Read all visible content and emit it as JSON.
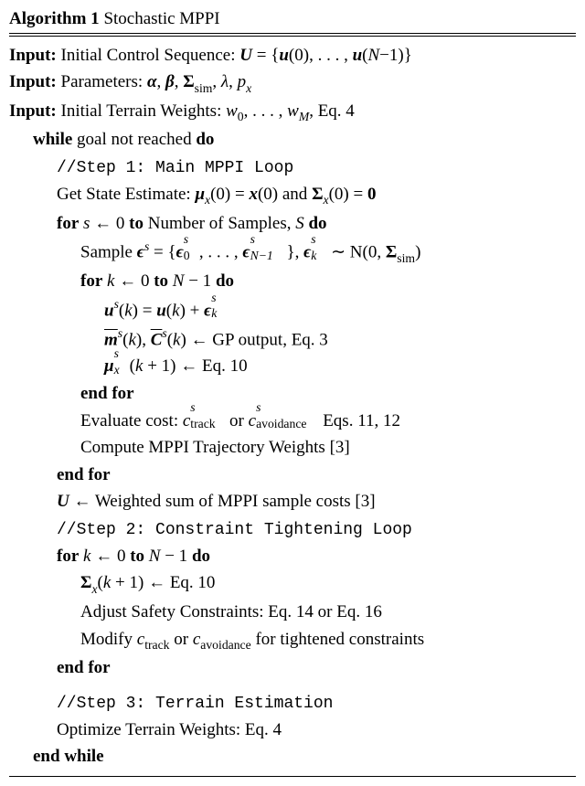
{
  "title": {
    "label_algorithm": "Algorithm 1",
    "name": "Stochastic MPPI"
  },
  "inputs": {
    "in1_label": "Input:",
    "in1_text_a": "Initial Control Sequence: ",
    "in1_U": "U",
    "in1_eq": " = {",
    "in1_u": "u",
    "in1_z0": "(0), . . . , ",
    "in1_u2": "u",
    "in1_z1": "(",
    "in1_N": "N",
    "in1_m1": "−1)}",
    "in2_label": "Input:",
    "in2_text": "Parameters: ",
    "in2_alpha": "α",
    "in2_c1": ", ",
    "in2_beta": "β",
    "in2_c2": ", ",
    "in2_Sigma": "Σ",
    "in2_sim": "sim",
    "in2_c3": ", ",
    "in2_lambda": "λ",
    "in2_c4": ", ",
    "in2_px_p": "p",
    "in2_px_x": "x",
    "in3_label": "Input:",
    "in3_text": "Initial Terrain Weights: ",
    "in3_w": "w",
    "in3_0": "0",
    "in3_dots": ", . . . , ",
    "in3_w2": "w",
    "in3_M": "M",
    "in3_ref": ", Eq. 4"
  },
  "lines": {
    "while_kw": "while",
    "while_cond": " goal not reached ",
    "do_kw": "do",
    "step1": "//Step 1: Main MPPI Loop",
    "getstate_a": "Get State Estimate: ",
    "mu": "μ",
    "x": "x",
    "zeroarg": "(0) = ",
    "xvec": "x",
    "zeroarg2": "(0) and ",
    "Sigma": "Σ",
    "zeroarg3": "(0) = ",
    "zeromat": "0",
    "for_kw": "for",
    "for1_a": "s",
    "for1_arrow": " ← 0 ",
    "to_kw": "to",
    "for1_b": " Number of Samples, ",
    "for1_S": "S",
    "sample_a": "Sample ",
    "eps": "ϵ",
    "s": "s",
    "sample_eq": " = {",
    "eps0": "ϵ",
    "sample_dots": ", . . . , ",
    "epsN": "ϵ",
    "Nminus1": "N−1",
    "sample_close": "}, ",
    "epsk": "ϵ",
    "k": "k",
    "tilde": " ∼ ",
    "Normal": "N",
    "normargs_a": "(0, ",
    "normargs_Sigma": "Σ",
    "normargs_sim": "sim",
    "normargs_b": ")",
    "for2_a": "k",
    "for2_arrow": " ← 0 ",
    "for2_b": " ",
    "for2_N": "N",
    "for2_m1": " − 1 ",
    "usk_u": "u",
    "usk_args": "(",
    "usk_k": "k",
    "usk_close": ") = ",
    "usk_u2": "u",
    "usk_args2": "(",
    "usk_k2": "k",
    "usk_close2": ") + ",
    "usk_eps": "ϵ",
    "mbar": "m",
    "Cbar": "C",
    "args_k": "(",
    "kk": "k",
    "args_close": ") ← GP output, Eq. 3",
    "comma": ", ",
    "mu_upd": "μ",
    "mu_upd_args": "(",
    "mu_upd_k": "k",
    "mu_upd_p1": " + 1) ← Eq. 10",
    "endfor_kw": "end for",
    "eval_a": "Evaluate cost: ",
    "c_it": "c",
    "track": "track",
    "or": " or ",
    "avoid": "avoidance",
    "eval_ref": " Eqs. 11, 12",
    "compute": "Compute MPPI Trajectory Weights [3]",
    "Uupd": "U",
    "Uupd_b": " ← Weighted sum of MPPI sample costs [3]",
    "step2": "//Step 2: Constraint Tightening Loop",
    "Sig_upd": "Σ",
    "Sig_upd_args": "(",
    "Sig_upd_k": "k",
    "Sig_upd_p1": " + 1) ← Eq. 10",
    "adjust": "Adjust Safety Constraints: Eq. 14 or Eq. 16",
    "modify_a": "Modify ",
    "modify_or": " or ",
    "modify_b": " for tightened constraints",
    "step3": "//Step 3: Terrain Estimation",
    "optimize": "Optimize Terrain Weights: Eq. 4",
    "endwhile_kw": "end while"
  }
}
